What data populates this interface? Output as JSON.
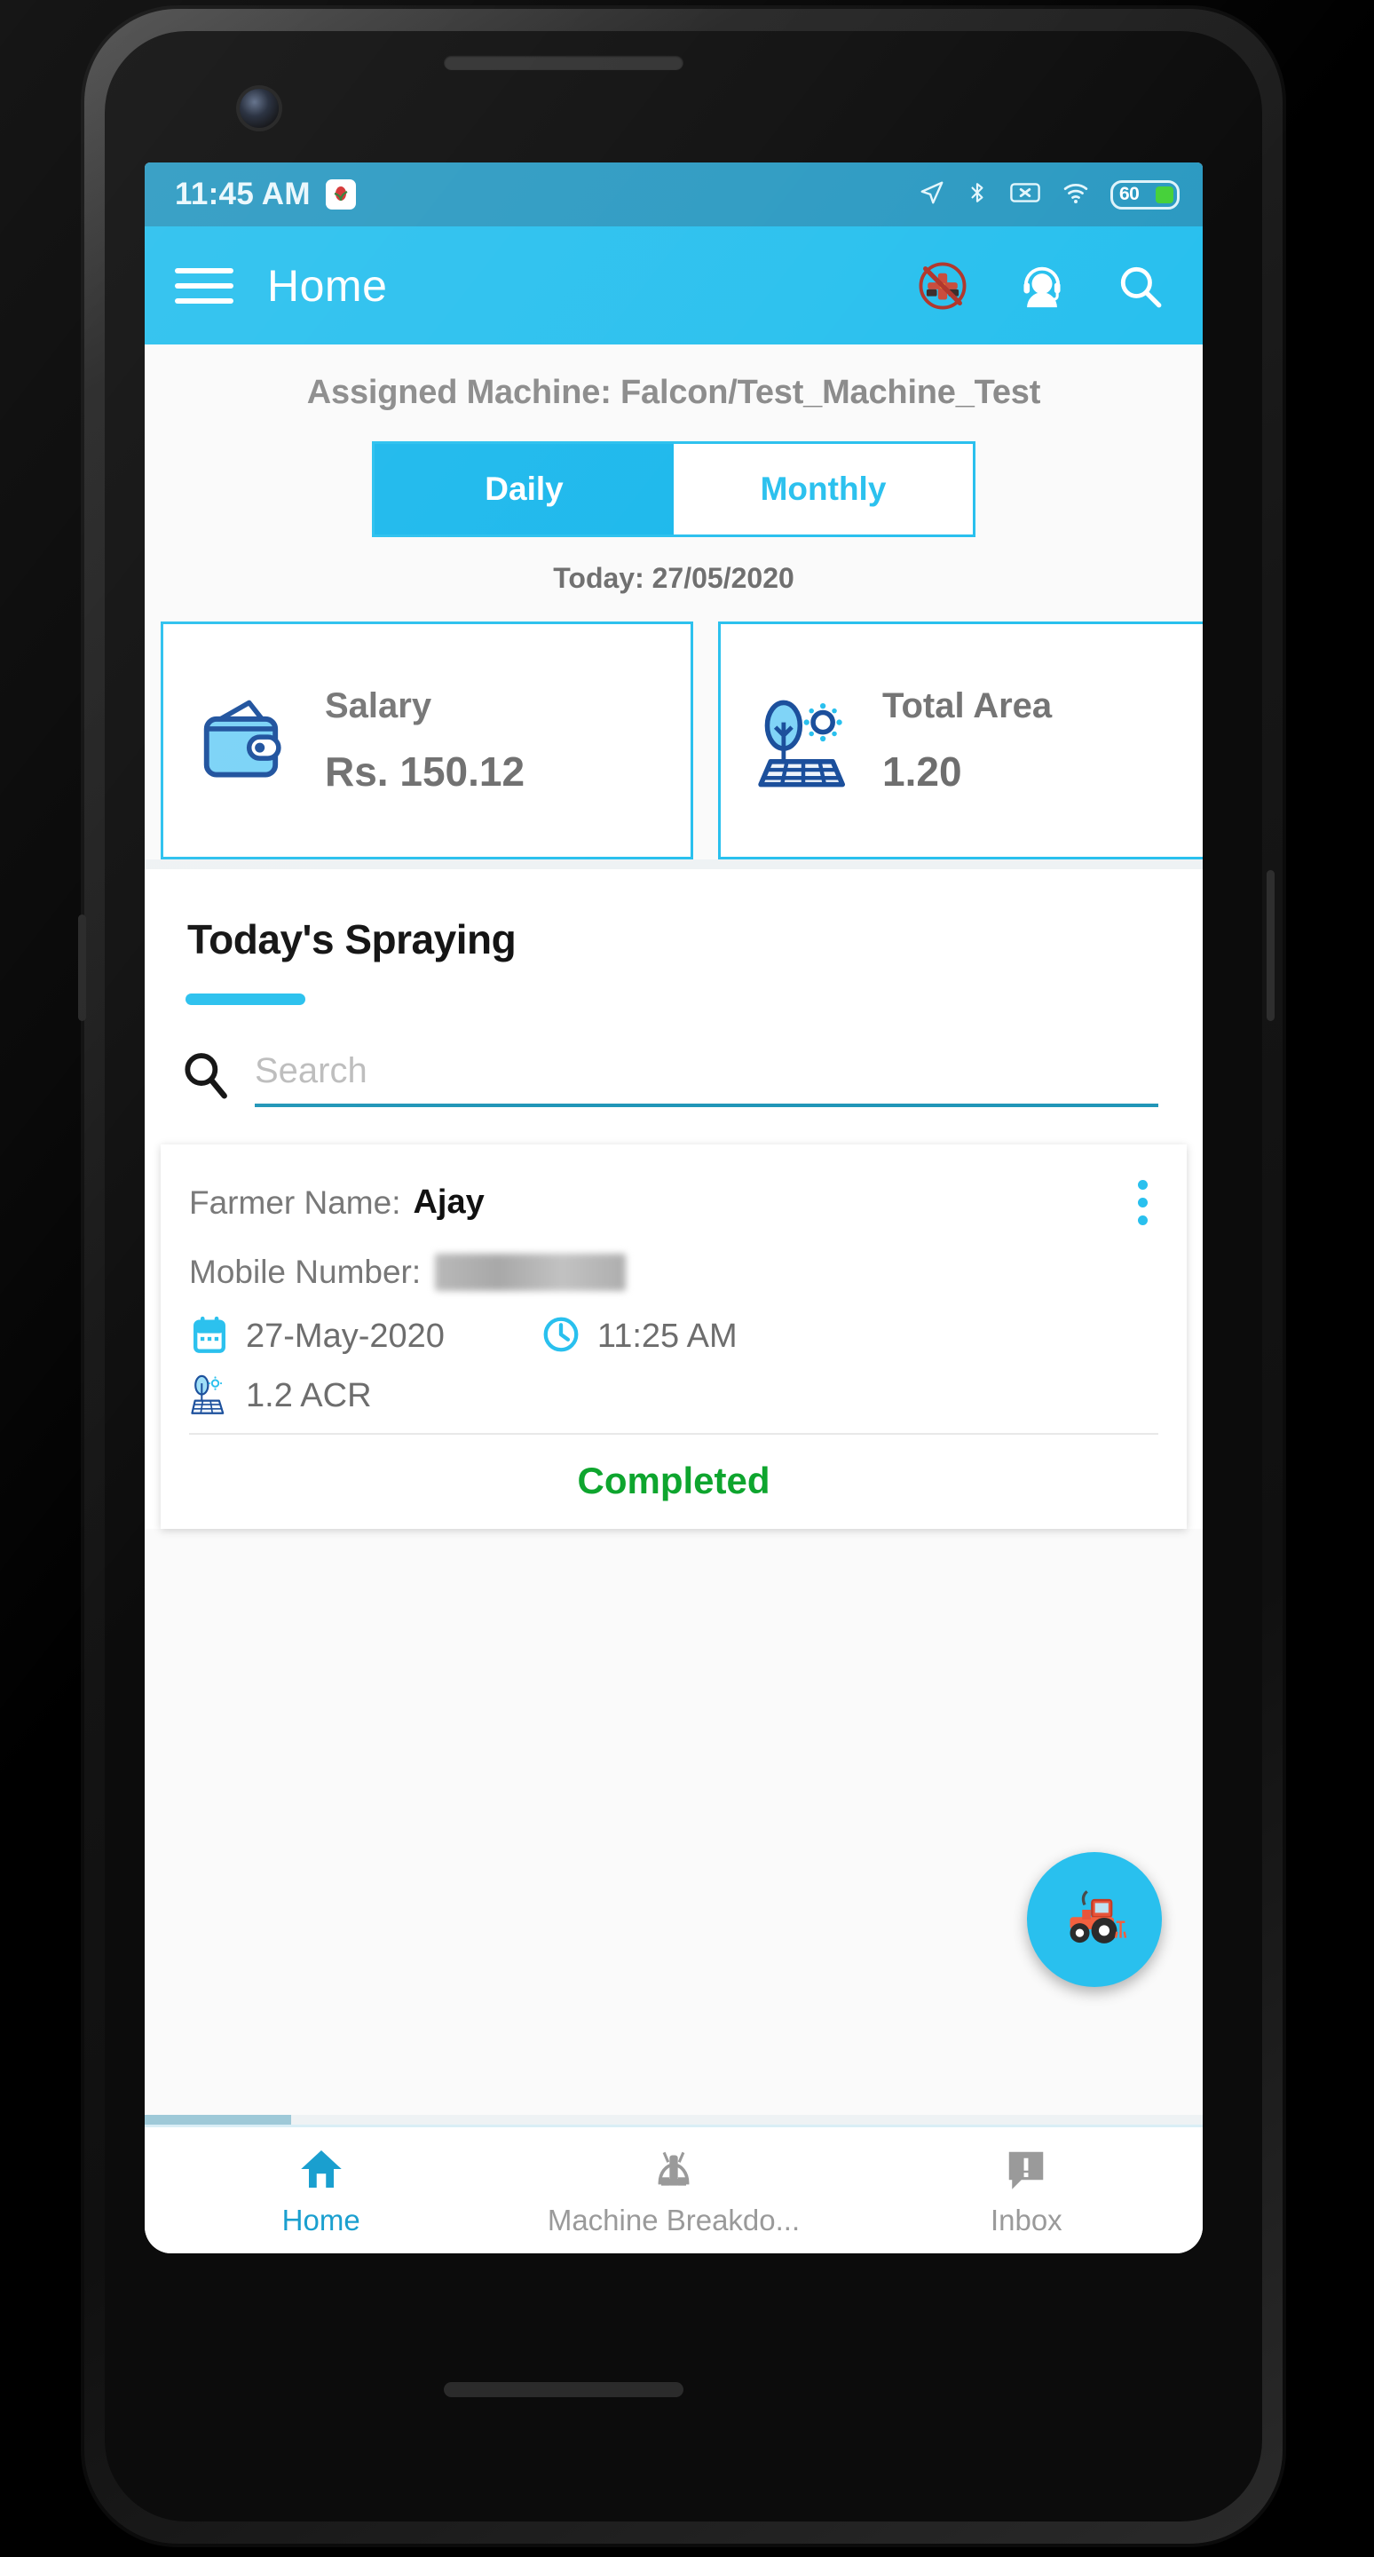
{
  "status_bar": {
    "time": "11:45 AM",
    "app_badge_icon": "app-notification-icon",
    "icons": [
      "location-arrow-icon",
      "bluetooth-icon",
      "sim-card-off-icon",
      "wifi-icon"
    ],
    "battery_level": "60"
  },
  "app_bar": {
    "menu_icon": "hamburger-menu-icon",
    "title": "Home",
    "actions": [
      {
        "name": "machine-breakdown-icon",
        "label": "Machine Breakdown"
      },
      {
        "name": "support-agent-icon",
        "label": "Support"
      },
      {
        "name": "search-icon",
        "label": "Search"
      }
    ]
  },
  "main": {
    "assigned_machine": "Assigned Machine: Falcon/Test_Machine_Test",
    "period_toggle": {
      "options": [
        "Daily",
        "Monthly"
      ],
      "selected": "Daily"
    },
    "today_label": "Today: 27/05/2020",
    "stat_cards": [
      {
        "icon": "wallet-icon",
        "label": "Salary",
        "value": "Rs. 150.12"
      },
      {
        "icon": "solar-tree-icon",
        "label": "Total Area",
        "value": "1.20"
      }
    ],
    "spraying": {
      "title": "Today's Spraying",
      "search_placeholder": "Search",
      "search_value": ""
    },
    "record": {
      "farmer_name_label": "Farmer Name:",
      "farmer_name": "Ajay",
      "mobile_label": "Mobile Number:",
      "mobile_value": "",
      "date_icon": "calendar-icon",
      "date": "27-May-2020",
      "time_icon": "clock-icon",
      "time": "11:25 AM",
      "area_icon": "solar-tree-icon",
      "area": "1.2 ACR",
      "status": "Completed",
      "menu_icon": "kebab-menu-icon"
    },
    "fab": {
      "icon": "tractor-icon",
      "glyph": "🚜"
    }
  },
  "bottom_nav": {
    "items": [
      {
        "icon": "home-icon",
        "label": "Home",
        "active": true
      },
      {
        "icon": "machine-breakdown-icon",
        "label": "Machine Breakdo...",
        "active": false
      },
      {
        "icon": "inbox-alert-icon",
        "label": "Inbox",
        "active": false
      }
    ]
  },
  "android_nav": {
    "back": "back-triangle-icon",
    "home": "home-circle-icon",
    "recents": "recents-square-icon"
  },
  "colors": {
    "status_bar": "#2C9AC2",
    "app_bar": "#29C0EE",
    "accent": "#29C0EE",
    "status_success": "#0EA52E",
    "muted_text": "#757575"
  }
}
